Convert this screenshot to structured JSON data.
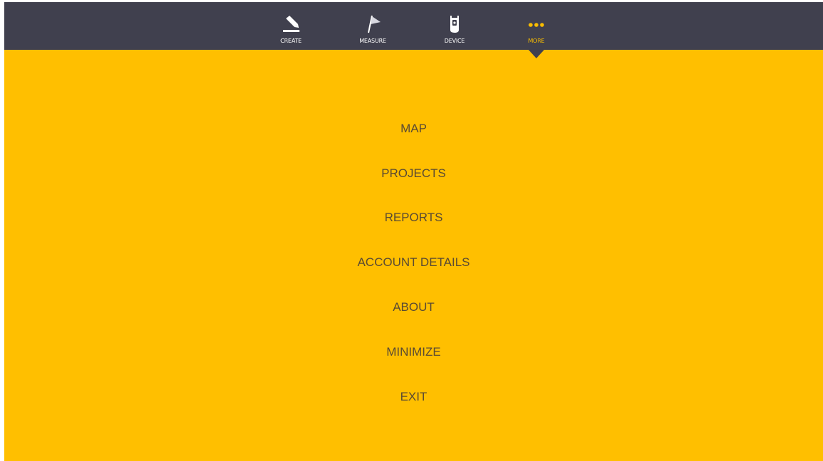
{
  "colors": {
    "topbar_bg": "#40404e",
    "accent": "#f9bd00",
    "panel_bg": "#ffbf00",
    "menu_text": "#5a4a33"
  },
  "nav": {
    "items": [
      {
        "label": "CREATE",
        "icon": "pencil-icon"
      },
      {
        "label": "MEASURE",
        "icon": "flag-icon"
      },
      {
        "label": "DEVICE",
        "icon": "device-icon"
      },
      {
        "label": "MORE",
        "icon": "more-dots-icon",
        "active": true
      }
    ]
  },
  "menu": {
    "items": [
      {
        "label": "MAP"
      },
      {
        "label": "PROJECTS"
      },
      {
        "label": "REPORTS"
      },
      {
        "label": "ACCOUNT DETAILS"
      },
      {
        "label": "ABOUT"
      },
      {
        "label": "MINIMIZE"
      },
      {
        "label": "EXIT"
      }
    ]
  }
}
